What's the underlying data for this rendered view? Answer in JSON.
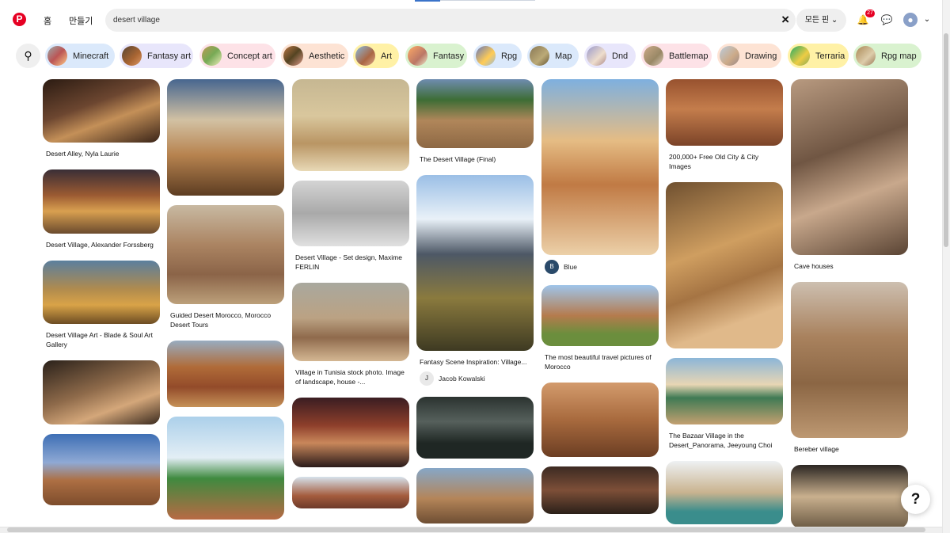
{
  "header": {
    "logo": "P",
    "nav_home": "홈",
    "nav_create": "만들기",
    "search_value": "desert village",
    "clear_icon": "×",
    "filter_label": "모든 핀",
    "notifications_count": "27",
    "profile_chevron": "⌄"
  },
  "filters": {
    "icon": "⚲",
    "chips": [
      {
        "label": "Minecraft",
        "color": "#dbe9fb"
      },
      {
        "label": "Fantasy art",
        "color": "#e8e6fb"
      },
      {
        "label": "Concept art",
        "color": "#fde2e7"
      },
      {
        "label": "Aesthetic",
        "color": "#fde3d4"
      },
      {
        "label": "Art",
        "color": "#fff1a6"
      },
      {
        "label": "Fantasy",
        "color": "#d9f2cf"
      },
      {
        "label": "Rpg",
        "color": "#dbe9fb"
      },
      {
        "label": "Map",
        "color": "#dbe9fb"
      },
      {
        "label": "Dnd",
        "color": "#e8e6fb"
      },
      {
        "label": "Battlemap",
        "color": "#fde2e7"
      },
      {
        "label": "Drawing",
        "color": "#fde3d4"
      },
      {
        "label": "Terraria",
        "color": "#fff1a6"
      },
      {
        "label": "Rpg map",
        "color": "#d9f2cf"
      }
    ]
  },
  "pins": {
    "columns": [
      [
        {
          "title": "Desert Alley, Nyla Laurie",
          "image": "alley"
        },
        {
          "title": "Desert Village, Alexander Forssberg",
          "image": "fantasy-village"
        },
        {
          "title": "Desert Village Art - Blade & Soul Art Gallery",
          "image": "blade-soul"
        },
        {
          "title": "",
          "image": "ruins"
        },
        {
          "title": "",
          "image": "kasbah"
        }
      ],
      [
        {
          "title": "",
          "image": "desert-city"
        },
        {
          "title": "Guided Desert Morocco, Morocco Desert Tours",
          "image": "morocco-hills"
        },
        {
          "title": "",
          "image": "canyon-city"
        },
        {
          "title": "",
          "image": "minecraft"
        }
      ],
      [
        {
          "title": "",
          "image": "tower-desert"
        },
        {
          "title": "Desert Village - Set design, Maxime FERLIN",
          "image": "sketches"
        },
        {
          "title": "Village in Tunisia stock photo. Image of landscape, house -...",
          "image": "tunisia"
        },
        {
          "title": "",
          "image": "ship-ruin"
        },
        {
          "title": "",
          "image": "market"
        }
      ],
      [
        {
          "title": "The Desert Village (Final)",
          "image": "palms"
        },
        {
          "title": "Fantasy Scene Inspiration: Village...",
          "image": "fantasy-scene",
          "author": "Jacob Kowalski",
          "author_initial": "J"
        },
        {
          "title": "",
          "image": "dark-swamp"
        },
        {
          "title": "",
          "image": "desert-building"
        }
      ],
      [
        {
          "title": "",
          "image": "camel",
          "author": "Blue",
          "author_initial": "B"
        },
        {
          "title": "The most beautiful travel pictures of Morocco",
          "image": "morocco"
        },
        {
          "title": "",
          "image": "wagons"
        },
        {
          "title": "",
          "image": "interior"
        }
      ],
      [
        {
          "title": "200,000+ Free Old City & City Images",
          "image": "old-city"
        },
        {
          "title": "",
          "image": "aerial"
        },
        {
          "title": "The Bazaar Village in the Desert_Panorama, Jeeyoung Choi",
          "image": "bazaar"
        },
        {
          "title": "",
          "image": "floating"
        }
      ],
      [
        {
          "title": "Cave houses",
          "image": "cave"
        },
        {
          "title": "Bereber village",
          "image": "bereber"
        },
        {
          "title": "",
          "image": "tree-village"
        }
      ]
    ]
  },
  "help_label": "?"
}
